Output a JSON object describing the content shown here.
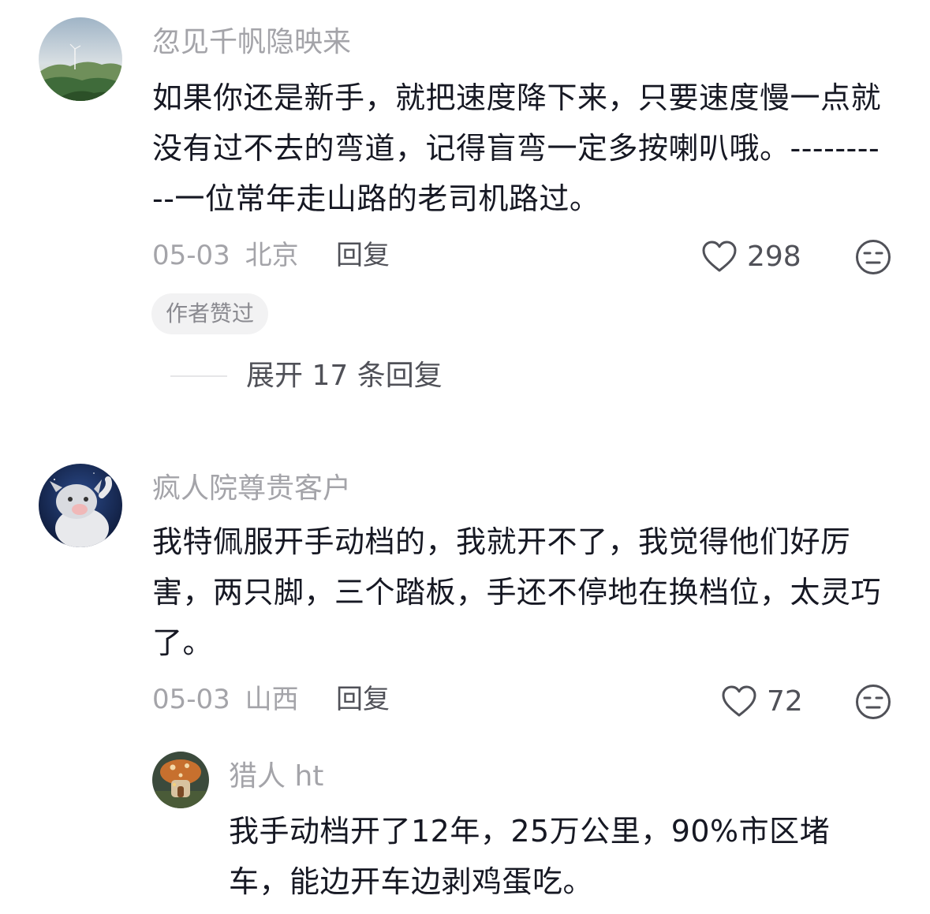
{
  "comments": [
    {
      "username": "忽见千帆隐映来",
      "text": "如果你还是新手，就把速度降下来，只要速度慢一点就没有过不去的弯道，记得盲弯一定多按喇叭哦。----------一位常年走山路的老司机路过。",
      "date": "05-03",
      "location": "北京",
      "reply_label": "回复",
      "likes": "298",
      "badge": "作者赞过",
      "expand_label": "展开 17 条回复",
      "avatar_icon": "landscape-avatar-icon"
    },
    {
      "username": "疯人院尊贵客户",
      "text": "我特佩服开手动档的，我就开不了，我觉得他们好厉害，两只脚，三个踏板，手还不停地在换档位，太灵巧了。",
      "date": "05-03",
      "location": "山西",
      "reply_label": "回复",
      "likes": "72",
      "avatar_icon": "cat-avatar-icon"
    }
  ],
  "reply": {
    "username": "猎人 ht",
    "text": "我手动档开了12年，25万公里，90%市区堵车，能边开车边剥鸡蛋吃。",
    "avatar_icon": "mushroom-house-avatar-icon"
  },
  "colors": {
    "text_primary": "#161823",
    "text_secondary": "#a4a4a9",
    "text_action": "#505158",
    "badge_bg": "#f2f2f3"
  }
}
